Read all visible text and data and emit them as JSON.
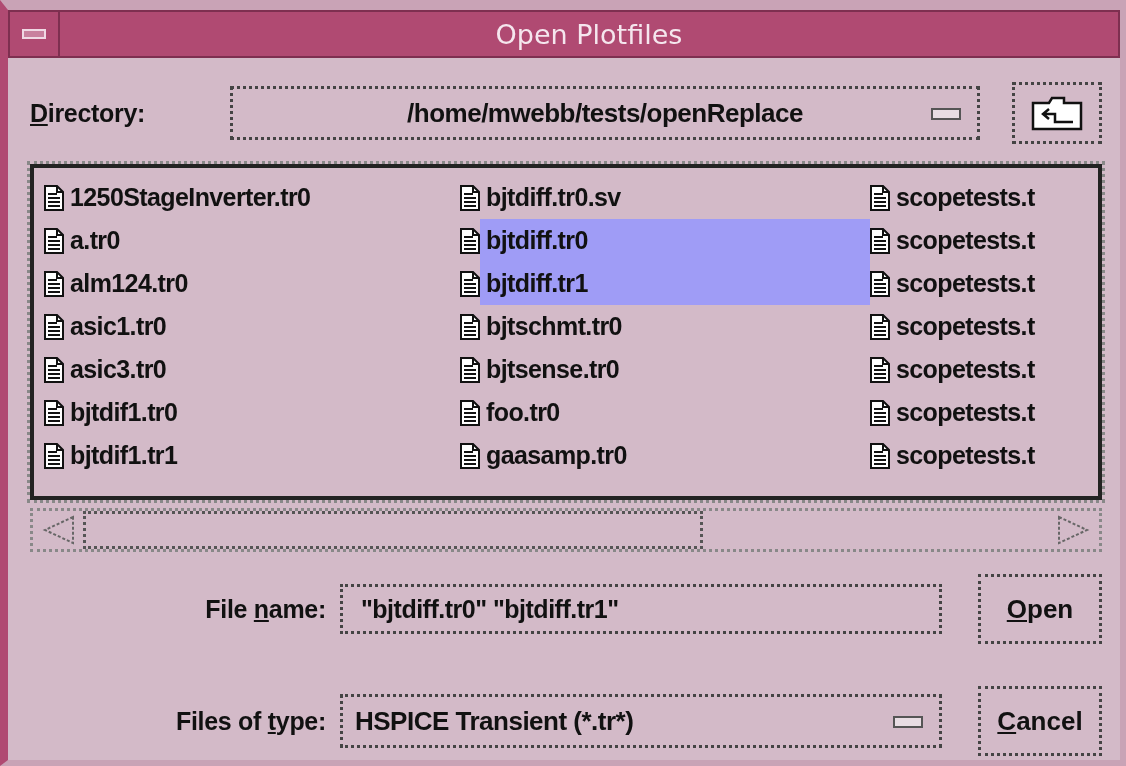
{
  "window": {
    "title": "Open Plotfiles"
  },
  "directory": {
    "label": {
      "key": "D",
      "after": "irectory:"
    },
    "value": "/home/mwebb/tests/openReplace"
  },
  "file_columns": [
    {
      "items": [
        {
          "name": "1250StageInverter.tr0",
          "selected": false
        },
        {
          "name": "a.tr0",
          "selected": false
        },
        {
          "name": "alm124.tr0",
          "selected": false
        },
        {
          "name": "asic1.tr0",
          "selected": false
        },
        {
          "name": "asic3.tr0",
          "selected": false
        },
        {
          "name": "bjtdif1.tr0",
          "selected": false
        },
        {
          "name": "bjtdif1.tr1",
          "selected": false
        }
      ]
    },
    {
      "items": [
        {
          "name": "bjtdiff.tr0.sv",
          "selected": false
        },
        {
          "name": "bjtdiff.tr0",
          "selected": true
        },
        {
          "name": "bjtdiff.tr1",
          "selected": true
        },
        {
          "name": "bjtschmt.tr0",
          "selected": false
        },
        {
          "name": "bjtsense.tr0",
          "selected": false
        },
        {
          "name": "foo.tr0",
          "selected": false
        },
        {
          "name": "gaasamp.tr0",
          "selected": false
        }
      ]
    },
    {
      "items": [
        {
          "name": "scopetests.t",
          "selected": false
        },
        {
          "name": "scopetests.t",
          "selected": false
        },
        {
          "name": "scopetests.t",
          "selected": false
        },
        {
          "name": "scopetests.t",
          "selected": false
        },
        {
          "name": "scopetests.t",
          "selected": false
        },
        {
          "name": "scopetests.t",
          "selected": false
        },
        {
          "name": "scopetests.t",
          "selected": false
        }
      ]
    }
  ],
  "file_name": {
    "label": {
      "before": "File ",
      "key": "n",
      "after": "ame:"
    },
    "value": "\"bjtdiff.tr0\" \"bjtdiff.tr1\""
  },
  "file_type": {
    "label": {
      "before": "Files of ",
      "key": "t",
      "after": "ype:"
    },
    "value": "HSPICE Transient (*.tr*)"
  },
  "buttons": [
    {
      "label": {
        "key": "O",
        "after": "pen"
      }
    },
    {
      "label": {
        "key": "C",
        "after": "ancel"
      }
    }
  ]
}
